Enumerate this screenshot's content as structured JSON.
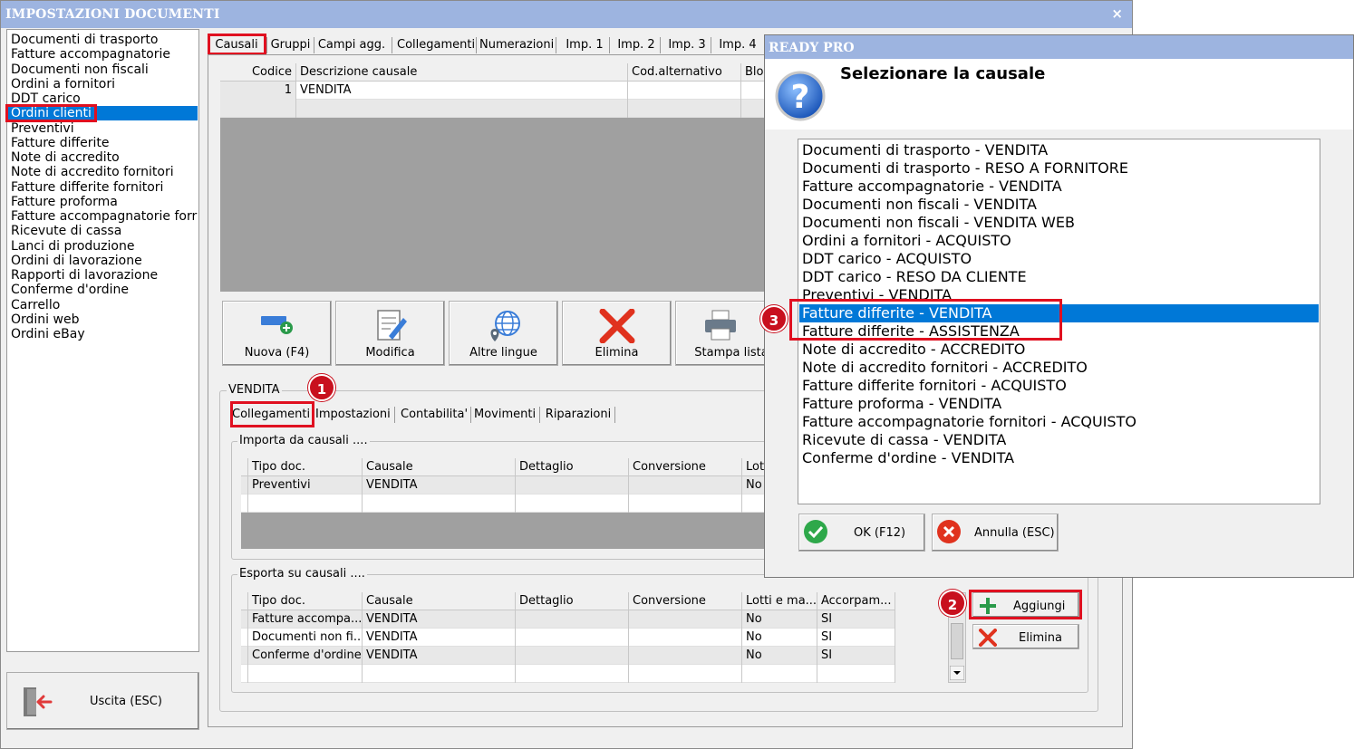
{
  "window": {
    "title": "IMPOSTAZIONI DOCUMENTI",
    "close_glyph": "×"
  },
  "document_types": [
    "Documenti di trasporto",
    "Fatture accompagnatorie",
    "Documenti non fiscali",
    "Ordini a fornitori",
    "DDT carico",
    "Ordini clienti",
    "Preventivi",
    "Fatture differite",
    "Note di accredito",
    "Note di accredito fornitori",
    "Fatture differite fornitori",
    "Fatture proforma",
    "Fatture accompagnatorie forr",
    "Ricevute di cassa",
    "Lanci di produzione",
    "Ordini di lavorazione",
    "Rapporti di lavorazione",
    "Conferme d'ordine",
    "Carrello",
    "Ordini web",
    "Ordini eBay"
  ],
  "selected_document_type": 5,
  "exit_button": "Uscita (ESC)",
  "tabs": [
    "Causali",
    "Gruppi",
    "Campi agg.",
    "Collegamenti",
    "Numerazioni",
    "Imp. 1",
    "Imp. 2",
    "Imp. 3",
    "Imp. 4"
  ],
  "causali_grid": {
    "columns": [
      "Codice",
      "Descrizione causale",
      "Cod.alternativo",
      "Bloc"
    ],
    "rows": [
      [
        "1",
        "VENDITA",
        "",
        ""
      ]
    ]
  },
  "toolbar": {
    "new": "Nuova (F4)",
    "edit": "Modifica",
    "languages": "Altre lingue",
    "delete": "Elimina",
    "print": "Stampa lista"
  },
  "selected_causale_group": "VENDITA",
  "subtabs": [
    "Collegamenti",
    "Impostazioni",
    "Contabilita'",
    "Movimenti",
    "Riparazioni"
  ],
  "import_section": {
    "title": "Importa da causali ....",
    "columns": [
      "Tipo doc.",
      "Causale",
      "Dettaglio",
      "Conversione",
      "Lott"
    ],
    "rows": [
      [
        "Preventivi",
        "VENDITA",
        "",
        "",
        "No"
      ]
    ]
  },
  "export_section": {
    "title": "Esporta su causali ....",
    "columns": [
      "Tipo doc.",
      "Causale",
      "Dettaglio",
      "Conversione",
      "Lotti e ma...",
      "Accorpam..."
    ],
    "rows": [
      [
        "Fatture accompa...",
        "VENDITA",
        "",
        "",
        "No",
        "SI"
      ],
      [
        "Documenti non fi...",
        "VENDITA",
        "",
        "",
        "No",
        "SI"
      ],
      [
        "Conferme d'ordine",
        "VENDITA",
        "",
        "",
        "No",
        "SI"
      ]
    ],
    "add_button": "Aggiungi",
    "delete_button": "Elimina"
  },
  "badges": [
    "1",
    "2",
    "3"
  ],
  "dialog": {
    "title": "READY PRO",
    "heading": "Selezionare la causale",
    "options": [
      "Documenti di trasporto - VENDITA",
      "Documenti di trasporto - RESO A FORNITORE",
      "Fatture accompagnatorie - VENDITA",
      "Documenti non fiscali - VENDITA",
      "Documenti non fiscali - VENDITA WEB",
      "Ordini a fornitori - ACQUISTO",
      "DDT carico - ACQUISTO",
      "DDT carico - RESO DA CLIENTE",
      "Preventivi - VENDITA",
      "Fatture differite - VENDITA",
      "Fatture differite - ASSISTENZA",
      "Note di accredito - ACCREDITO",
      "Note di accredito fornitori - ACCREDITO",
      "Fatture differite fornitori - ACQUISTO",
      "Fatture proforma - VENDITA",
      "Fatture accompagnatorie fornitori - ACQUISTO",
      "Ricevute di cassa - VENDITA",
      "Conferme d'ordine - VENDITA"
    ],
    "selected_option": 9,
    "ok_button": "OK (F12)",
    "cancel_button": "Annulla (ESC)"
  },
  "colors": {
    "titlebar": "#9db4e0",
    "selection": "#0078d7",
    "highlight_box": "#e01020",
    "badge": "#c8101e"
  },
  "icons": {
    "new": "new-document-plus-icon",
    "edit": "edit-pencil-icon",
    "languages": "globe-icon",
    "delete": "red-x-icon",
    "print": "printer-icon",
    "exit": "exit-door-icon",
    "question": "question-icon",
    "ok": "check-icon",
    "cancel": "cancel-icon",
    "add": "plus-icon"
  }
}
